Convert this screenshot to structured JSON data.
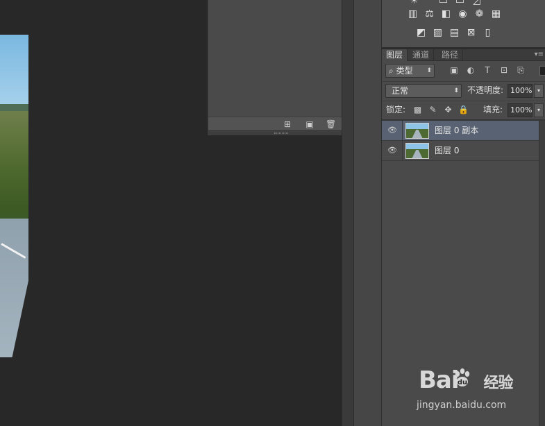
{
  "canvas": {
    "image": "highway-photo"
  },
  "history_panel": {
    "footer_icons": [
      "new-snapshot-icon",
      "camera-icon",
      "trash-icon"
    ]
  },
  "adjustments": {
    "row1_icons": [
      "sun-icon",
      "levels-icon",
      "curves-icon"
    ],
    "row2_icons": [
      "color-balance-icon",
      "balance-scale-icon",
      "black-white-icon",
      "photo-filter-icon",
      "channel-mixer-icon",
      "color-lookup-icon"
    ],
    "row3_icons": [
      "invert-icon",
      "posterize-icon",
      "threshold-icon",
      "selective-color-icon",
      "gradient-map-icon"
    ]
  },
  "layers_panel": {
    "tabs": [
      {
        "label": "图层",
        "active": true
      },
      {
        "label": "通道",
        "active": false
      },
      {
        "label": "路径",
        "active": false
      }
    ],
    "filter": {
      "label": "类型"
    },
    "blend_mode": "正常",
    "opacity_label": "不透明度:",
    "opacity_value": "100%",
    "lock_label": "锁定:",
    "fill_label": "填充:",
    "fill_value": "100%",
    "layers": [
      {
        "name": "图层 0 副本",
        "selected": true,
        "visible": true
      },
      {
        "name": "图层 0",
        "selected": false,
        "visible": true
      }
    ]
  },
  "watermark": {
    "logo_text": "Bai",
    "logo_text2": "经验",
    "url": "jingyan.baidu.com"
  },
  "colors": {
    "selected_row": "#596272",
    "panel_bg": "#4a4a4a",
    "canvas_bg": "#282828"
  }
}
